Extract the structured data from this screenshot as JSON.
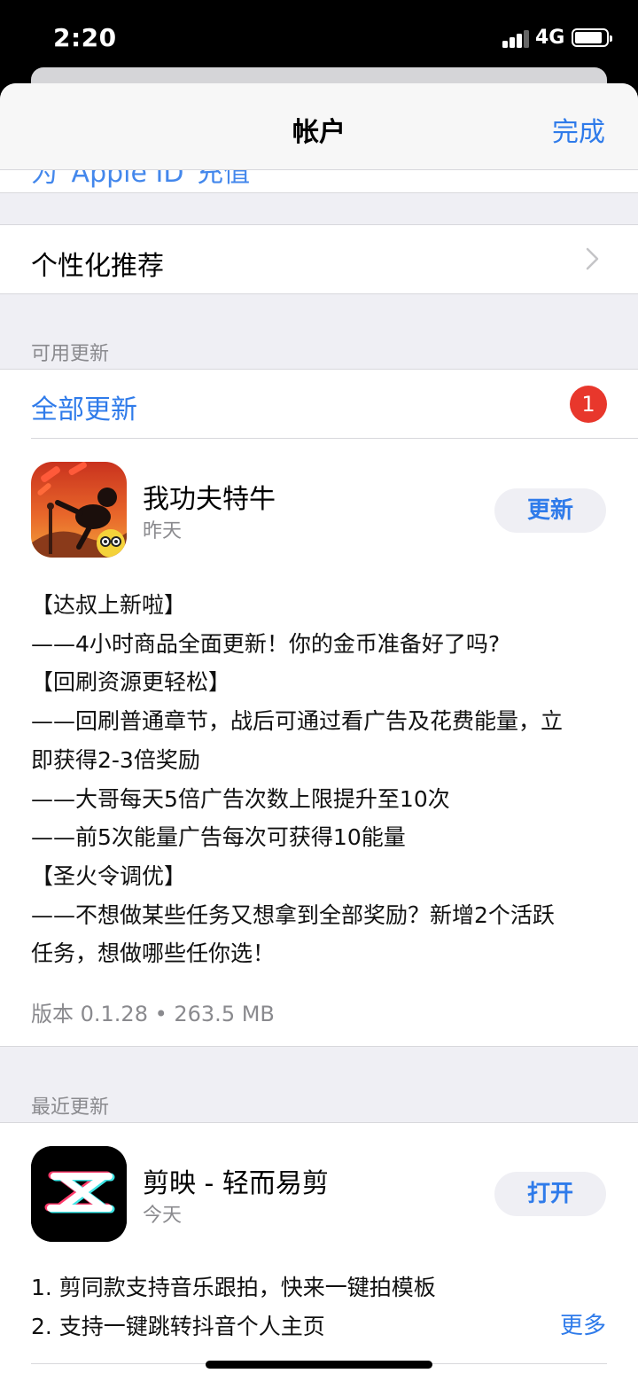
{
  "status_bar": {
    "time": "2:20",
    "network": "4G"
  },
  "nav": {
    "title": "帐户",
    "done_label": "完成"
  },
  "clipped_row": {
    "label": "为“Apple ID”充值"
  },
  "personalized": {
    "label": "个性化推荐"
  },
  "available_updates": {
    "header": "可用更新",
    "update_all_label": "全部更新",
    "badge_count": "1",
    "app": {
      "name": "我功夫特牛",
      "date": "昨天",
      "button_label": "更新",
      "notes": [
        "【达叔上新啦】",
        "——4小时商品全面更新！你的金币准备好了吗?",
        "【回刷资源更轻松】",
        "——回刷普通章节，战后可通过看广告及花费能量，立",
        "即获得2-3倍奖励",
        "——大哥每天5倍广告次数上限提升至10次",
        "——前5次能量广告每次可获得10能量",
        "【圣火令调优】",
        "——不想做某些任务又想拿到全部奖励？新增2个活跃",
        "任务，想做哪些任你选！"
      ],
      "version_line": "版本 0.1.28 • 263.5 MB"
    }
  },
  "recent_updates": {
    "header": "最近更新",
    "app": {
      "name": "剪映 - 轻而易剪",
      "date": "今天",
      "button_label": "打开",
      "notes": [
        "1. 剪同款支持音乐跟拍，快来一键拍模板",
        "2. 支持一键跳转抖音个人主页"
      ],
      "more_label": "更多"
    }
  },
  "colors": {
    "accent": "#2f7bea",
    "badge": "#e8372c",
    "group_bg": "#efeff4"
  }
}
